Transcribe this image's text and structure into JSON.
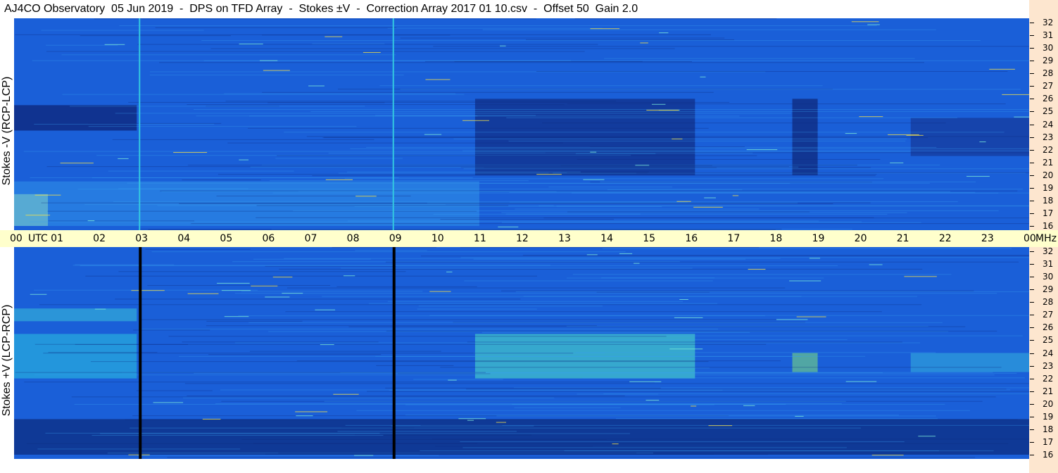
{
  "title": "AJ4CO Observatory  05 Jun 2019  -  DPS on TFD Array  -  Stokes ±V  -  Correction Array 2017 01 10.csv  -  Offset 50  Gain 2.0",
  "chart_data": [
    {
      "type": "heatmap",
      "panel": "top",
      "ylabel": "Stokes -V (RCP-LCP)",
      "x_axis": {
        "unit": "UTC",
        "range_hours": [
          0,
          24
        ]
      },
      "y_axis": {
        "unit": "MHz",
        "range": [
          16,
          32
        ]
      },
      "background_color": "#1a5fd8",
      "vertical_lines": [
        {
          "time_hours": 2.95,
          "color": "#33c8e0"
        },
        {
          "time_hours": 8.95,
          "color": "#33c8e0"
        }
      ]
    },
    {
      "type": "heatmap",
      "panel": "bottom",
      "ylabel": "Stokes +V (LCP-RCP)",
      "x_axis": {
        "unit": "UTC",
        "range_hours": [
          0,
          24
        ]
      },
      "y_axis": {
        "unit": "MHz",
        "range": [
          16,
          32
        ]
      },
      "background_color": "#1a5fd8",
      "vertical_lines": [
        {
          "time_hours": 2.95,
          "color": "#000000"
        },
        {
          "time_hours": 8.95,
          "color": "#000000"
        }
      ]
    }
  ],
  "time_axis": {
    "labels": [
      "00",
      "01",
      "02",
      "03",
      "04",
      "05",
      "06",
      "07",
      "08",
      "09",
      "10",
      "11",
      "12",
      "13",
      "14",
      "15",
      "16",
      "17",
      "18",
      "19",
      "20",
      "21",
      "22",
      "23",
      "00"
    ],
    "utc_label": "UTC",
    "mhz_label": "MHz"
  },
  "freq_labels": [
    "32",
    "31",
    "30",
    "29",
    "28",
    "27",
    "26",
    "25",
    "24",
    "23",
    "22",
    "21",
    "20",
    "19",
    "18",
    "17",
    "16"
  ],
  "colors": {
    "right_bar": "#fde6cf",
    "time_bar": "#ffffcc"
  }
}
